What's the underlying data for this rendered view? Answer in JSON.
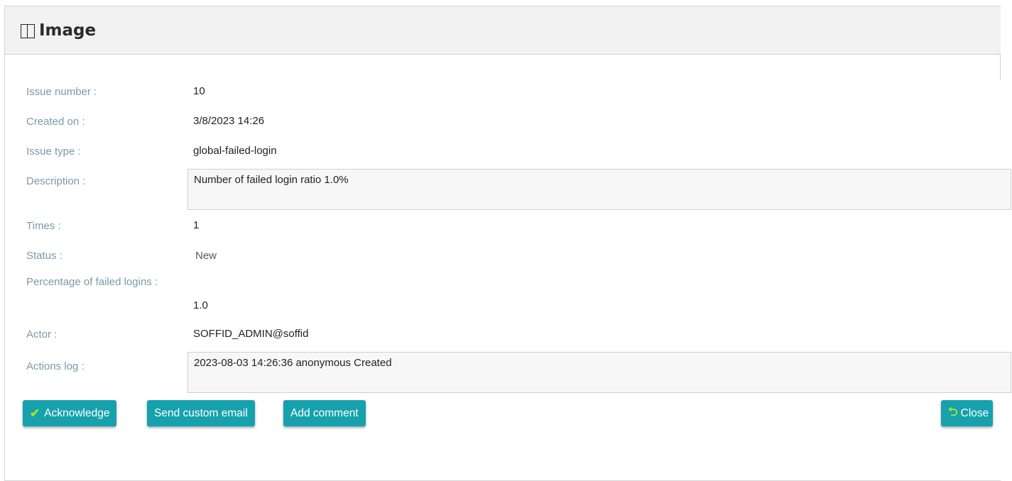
{
  "window": {
    "title": "Image",
    "icon": "book-icon"
  },
  "fields": {
    "issue_number": {
      "label": "Issue number :",
      "value": "10"
    },
    "created_on": {
      "label": "Created on :",
      "value": "3/8/2023 14:26"
    },
    "issue_type": {
      "label": "Issue type :",
      "value": "global-failed-login"
    },
    "description": {
      "label": "Description :",
      "value": "Number of failed login ratio 1.0%"
    },
    "times": {
      "label": "Times :",
      "value": "1"
    },
    "status": {
      "label": "Status :",
      "value": "New"
    },
    "percentage": {
      "label": "Percentage of failed logins :",
      "value": "1.0"
    },
    "actor": {
      "label": "Actor :",
      "value": "SOFFID_ADMIN@soffid"
    },
    "actions_log": {
      "label": "Actions log :",
      "value": "2023-08-03 14:26:36 anonymous Created"
    }
  },
  "buttons": {
    "acknowledge": "Acknowledge",
    "send_email": "Send custom email",
    "add_comment": "Add comment",
    "close": "Close"
  },
  "colors": {
    "button_bg": "#17a1ad",
    "label": "#7a9aa8",
    "icon_accent": "#a6e22e"
  }
}
